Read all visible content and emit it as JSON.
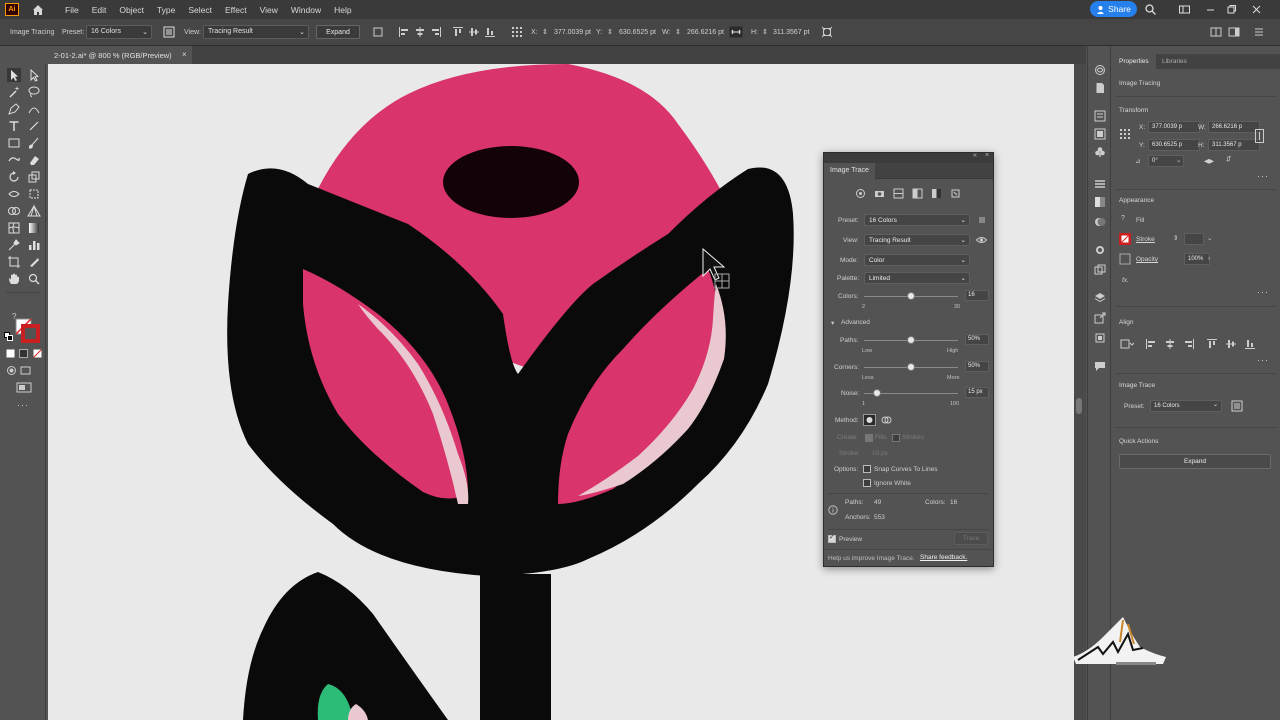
{
  "app": {
    "logo_text": "Ai",
    "menu": [
      "File",
      "Edit",
      "Object",
      "Type",
      "Select",
      "Effect",
      "View",
      "Window",
      "Help"
    ],
    "share_label": "Share"
  },
  "control_bar": {
    "mode_label": "Image Tracing",
    "preset_label": "Preset:",
    "preset_value": "16 Colors",
    "view_label": "View:",
    "view_value": "Tracing Result",
    "expand_label": "Expand",
    "x_label": "X:",
    "x_value": "377.0039 pt",
    "y_label": "Y:",
    "y_value": "630.6525 pt",
    "w_label": "W:",
    "w_value": "266.6216 pt",
    "h_label": "H:",
    "h_value": "311.3567 pt"
  },
  "document": {
    "tab_title": "2-01-2.ai* @ 800 % (RGB/Preview)",
    "close_glyph": "×"
  },
  "image_trace": {
    "title": "Image Trace",
    "preset_label": "Preset:",
    "preset_value": "16 Colors",
    "view_label": "View:",
    "view_value": "Tracing Result",
    "mode_label": "Mode:",
    "mode_value": "Color",
    "palette_label": "Palette:",
    "palette_value": "Limited",
    "colors_label": "Colors:",
    "colors_value": "16",
    "colors_min": "2",
    "colors_max": "30",
    "colors_fraction": 0.5,
    "advanced_label": "Advanced",
    "paths_label": "Paths:",
    "paths_value": "50%",
    "paths_low": "Low",
    "paths_high": "High",
    "paths_fraction": 0.5,
    "corners_label": "Corners:",
    "corners_value": "50%",
    "corners_less": "Less",
    "corners_more": "More",
    "corners_fraction": 0.5,
    "noise_label": "Noise:",
    "noise_value": "15 px",
    "noise_min": "1",
    "noise_max": "100",
    "noise_fraction": 0.14,
    "method_label": "Method:",
    "create_label": "Create:",
    "fills_label": "Fills",
    "strokes_label": "Strokes",
    "stroke_label": "Stroke:",
    "stroke_value": "10 px",
    "options_label": "Options:",
    "snap_label": "Snap Curves To Lines",
    "ignore_white_label": "Ignore White",
    "stats_paths_label": "Paths:",
    "stats_paths_value": "49",
    "stats_colors_label": "Colors:",
    "stats_colors_value": "16",
    "stats_anchors_label": "Anchors:",
    "stats_anchors_value": "553",
    "preview_label": "Preview",
    "trace_button": "Trace",
    "footer_text": "Help us improve Image Trace.",
    "footer_link": "Share feedback."
  },
  "properties": {
    "tab_properties": "Properties",
    "tab_libraries": "Libraries",
    "object_type": "Image Tracing",
    "transform_label": "Transform",
    "x_label": "X:",
    "x_value": "377.0039 p",
    "y_label": "Y:",
    "y_value": "630.6525 p",
    "w_label": "W:",
    "w_value": "266.6216 p",
    "h_label": "H:",
    "h_value": "311.3567 p",
    "angle_value": "0°",
    "appearance_label": "Appearance",
    "fill_label": "Fill",
    "stroke_label": "Stroke",
    "opacity_label": "Opacity",
    "opacity_value": "100%",
    "fx_label": "fx.",
    "align_label": "Align",
    "image_trace_label": "Image Trace",
    "preset_label": "Preset:",
    "preset_value": "16 Colors",
    "quick_actions_label": "Quick Actions",
    "expand_label": "Expand"
  },
  "colors": {
    "pink": "#d9346b",
    "black": "#0a0a0a",
    "highlight": "#e9c9cf",
    "green": "#2dbb78",
    "canvas": "#e9e9e9",
    "accent": "#2680eb"
  }
}
